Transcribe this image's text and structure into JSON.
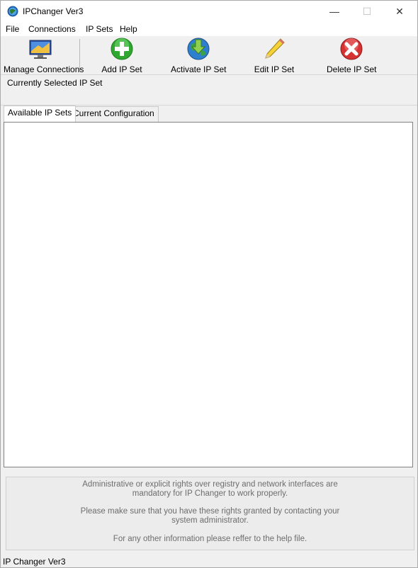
{
  "window": {
    "title": "IPChanger Ver3",
    "controls": {
      "minimize": "—",
      "maximize": "☐",
      "close": "✕"
    }
  },
  "menu": {
    "items": [
      {
        "label": "File"
      },
      {
        "label": "Connections"
      },
      {
        "label": "IP Sets"
      },
      {
        "label": "Help"
      }
    ]
  },
  "toolbar": {
    "manage_connections": {
      "label": "Manage Connections",
      "icon": "monitor-icon"
    },
    "add": {
      "label": "Add IP Set",
      "icon": "add-icon",
      "color": "#2fa82f"
    },
    "activate": {
      "label": "Activate IP Set",
      "icon": "globe-arrow-icon",
      "color": "#2e7fd0"
    },
    "edit": {
      "label": "Edit IP Set",
      "icon": "pencil-icon",
      "color": "#f4d23a"
    },
    "delete": {
      "label": "Delete IP Set",
      "icon": "delete-icon",
      "color": "#d63232"
    }
  },
  "selected": {
    "label": "Currently Selected IP Set"
  },
  "tabs": [
    {
      "label": "Available IP Sets",
      "active": true
    },
    {
      "label": "Current Configuration",
      "active": false
    }
  ],
  "info": {
    "lines": [
      "Administrative or explicit rights over registry and network interfaces are",
      "mandatory for IP Changer to work properly.",
      "Please make sure that you have these rights granted by contacting your",
      "system administrator.",
      "For any other information please reffer to the help file."
    ]
  },
  "status": {
    "text": "IP Changer Ver3"
  }
}
